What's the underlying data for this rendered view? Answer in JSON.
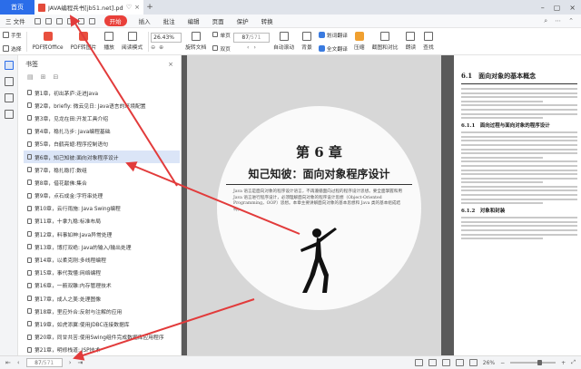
{
  "titlebar": {
    "home_tab": "首页",
    "doc_tab": "JAVA编程兵书[jb51.net].pdf",
    "add_tab": "+"
  },
  "menubar": {
    "file": "三 文件",
    "start": "开始",
    "items": [
      "插入",
      "批注",
      "编辑",
      "页面",
      "保护",
      "转换"
    ]
  },
  "toolbar": {
    "hand": "手型",
    "select": "选择",
    "pdf_to_office": "PDF转Office",
    "pdf_to_image": "PDF转图片",
    "play": "播放",
    "read_mode": "阅读模式",
    "zoom": "26.43%",
    "rotate": "旋转文档",
    "single_page": "单页",
    "double_page": "双页",
    "page_value": "87",
    "page_total": "/571",
    "auto_scroll": "自动滚动",
    "background": "背景",
    "translate": "划词翻译",
    "full_translate": "全文翻译",
    "compress": "压缩",
    "screenshot_compare": "截图和对比",
    "read_aloud": "朗读",
    "find": "查找"
  },
  "bookmarks": {
    "title": "书签",
    "close": "×",
    "items": [
      "第1章，初出茅庐:走进Java",
      "第2章，briefly: 微云见日: Java语言的环境配置",
      "第3章，见龙在田:开发工具介绍",
      "第4章，稳扎马步: Java编程基础",
      "第5章，白鹤亮翅:程序控制语句",
      "第6章，知己知彼:面向对象程序设计",
      "第7章，稳扎稳打:数组",
      "第8章，借花献佛:集合",
      "第9章，点石成金:字符串处理",
      "第10章，云行雨施: Java Swing编程",
      "第11章，十拿九稳:标准布局",
      "第12章，料事如神:Java异常处理",
      "第13章，博打双绝: Java的输入/输出处理",
      "第14章，以柔克刚:多线程编程",
      "第15章，事代我懂:网络编程",
      "第16章，一箭双雕:内存管理技术",
      "第17章，成人之美:处理图像",
      "第18章，里应外合:反射与注解的应用",
      "第19章，如虎添翼:使用JDBC连接数据库",
      "第20章，同甘共苦:使用Swing组件完成数据库应用程序",
      "第21章，明修栈道: JSP技术"
    ]
  },
  "page": {
    "chapter_no": "第 6 章",
    "chapter_title": "知己知彼：面向对象程序设计",
    "intro": "Java 语言是面向对象的程序设计语言，不再遵循面向过程的程序设计思想。要全面掌握和用 Java 语言进行程序设计，必须理解面向对象的程序设计思想（Object-Oriented Programming，OOP）思想。本章主要讲解面向对象的基本思想和 Java 类的基本组成结构。",
    "right_heading": "6.1　面向对象的基本概念",
    "right_sub1": "6.1.1　面向过程与面向对象的程序设计",
    "right_sub2": "6.1.2　对象和封装"
  },
  "statusbar": {
    "page_value": "87",
    "page_total": "/571",
    "zoom": "26%"
  },
  "colors": {
    "accent": "#2b6de9",
    "start_button": "#e9403a",
    "arrow": "#e23b3b"
  }
}
